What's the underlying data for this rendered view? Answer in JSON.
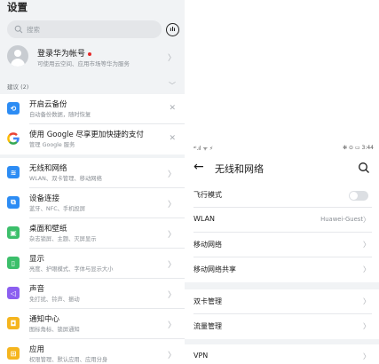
{
  "left": {
    "title": "设置",
    "search_placeholder": "搜索",
    "account": {
      "title": "登录华为帐号",
      "subtitle": "可使用云空间、应用市场等华为服务"
    },
    "suggestions_label": "建议 (2)",
    "suggestions": [
      {
        "title": "开启云备份",
        "subtitle": "自动备份数据，随时恢复",
        "icon": "cloud-backup-icon",
        "color": "#2c8cf4"
      },
      {
        "title": "使用 Google 尽享更加快捷的支付",
        "subtitle": "管理 Google 服务",
        "icon": "google-icon",
        "color": "#ffffff"
      }
    ],
    "settings": [
      {
        "title": "无线和网络",
        "subtitle": "WLAN、双卡管理、移动网络",
        "icon": "wifi-icon",
        "color": "#2c8cf4"
      },
      {
        "title": "设备连接",
        "subtitle": "蓝牙、NFC、手机投屏",
        "icon": "device-connect-icon",
        "color": "#2c8cf4"
      },
      {
        "title": "桌面和壁纸",
        "subtitle": "杂志锁屏、主题、灭屏显示",
        "icon": "wallpaper-icon",
        "color": "#3cbf6b"
      },
      {
        "title": "显示",
        "subtitle": "亮度、护眼模式、字体与显示大小",
        "icon": "display-icon",
        "color": "#3cbf6b"
      },
      {
        "title": "声音",
        "subtitle": "免打扰、铃声、振动",
        "icon": "sound-icon",
        "color": "#8c5ff0"
      },
      {
        "title": "通知中心",
        "subtitle": "图标角标、锁屏通知",
        "icon": "notification-icon",
        "color": "#f5b51e"
      },
      {
        "title": "应用",
        "subtitle": "权限管理、默认应用、应用分身",
        "icon": "apps-icon",
        "color": "#f5b51e"
      }
    ]
  },
  "right": {
    "status_left": "ᵃˡ.ıl ᯤ ⚡",
    "status_right": "✻ ⊙ ▭ 3:44",
    "title": "无线和网络",
    "rows": [
      {
        "label": "飞行模式",
        "type": "toggle"
      },
      {
        "label": "WLAN",
        "value": "Huawei-Guest"
      },
      {
        "label": "移动网络"
      },
      {
        "label": "移动网络共享"
      },
      {
        "label": "双卡管理"
      },
      {
        "label": "流量管理"
      },
      {
        "label": "VPN"
      }
    ]
  }
}
